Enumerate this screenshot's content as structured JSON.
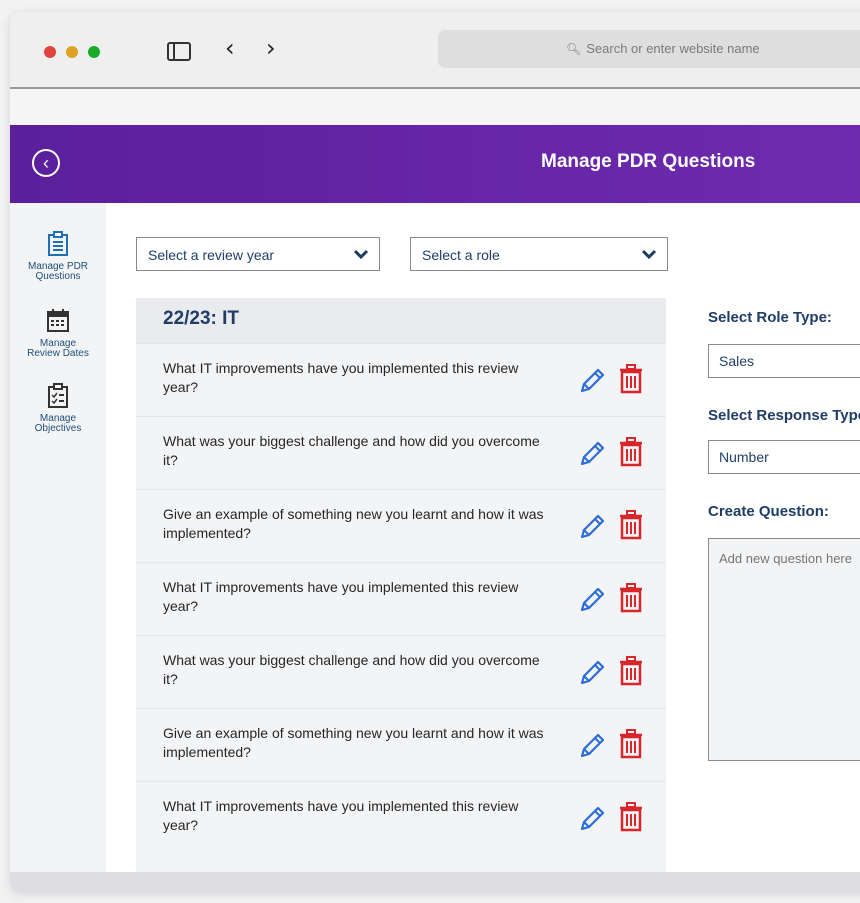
{
  "browser": {
    "search_placeholder": "Search or enter website name"
  },
  "header": {
    "title": "Manage PDR Questions"
  },
  "sidebar": {
    "items": [
      {
        "line1": "Manage PDR",
        "line2": "Questions",
        "icon": "clipboard-list-icon"
      },
      {
        "line1": "Manage",
        "line2": "Review Dates",
        "icon": "calendar-icon"
      },
      {
        "line1": "Manage",
        "line2": "Objectives",
        "icon": "checklist-icon"
      }
    ]
  },
  "filters": {
    "review_year": "Select a review year",
    "role": "Select a role"
  },
  "panel": {
    "title": "22/23: IT",
    "questions": [
      "What IT improvements have you implemented this review year?",
      "What was your biggest challenge and how did you overcome it?",
      "Give an example of something new you learnt and how it was implemented?",
      "What IT improvements have you implemented this review year?",
      "What was your biggest challenge and how did you overcome it?",
      "Give an example of something new you learnt and how it was implemented?",
      "What IT improvements have you implemented this review year?"
    ]
  },
  "form": {
    "role_type_label": "Select Role Type:",
    "role_type_value": "Sales",
    "response_type_label": "Select Response Type:",
    "response_type_value": "Number",
    "create_question_label": "Create Question:",
    "question_placeholder": "Add new question here"
  },
  "colors": {
    "header_purple": "#6a28aa",
    "text_navy": "#1f3d66",
    "edit_blue": "#2b6cd6",
    "delete_red": "#d9262b"
  }
}
